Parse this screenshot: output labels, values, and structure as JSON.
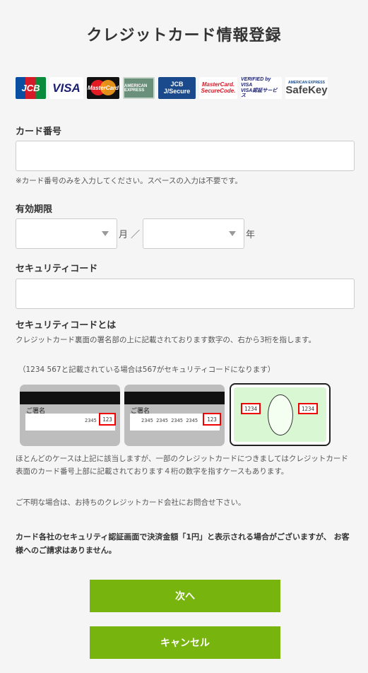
{
  "title": "クレジットカード情報登録",
  "logos": [
    {
      "name": "jcb",
      "text": "JCB"
    },
    {
      "name": "visa",
      "text": "VISA"
    },
    {
      "name": "mastercard",
      "text": "MasterCard"
    },
    {
      "name": "amex",
      "text": "AMERICAN EXPRESS"
    },
    {
      "name": "jsecure",
      "top": "JCB",
      "bottom": "J/Secure"
    },
    {
      "name": "mc-securecode",
      "top": "MasterCard.",
      "bottom": "SecureCode."
    },
    {
      "name": "verified-by-visa",
      "top": "VERIFIED by VISA",
      "bottom": "VISA認証サービス"
    },
    {
      "name": "safekey",
      "top": "AMERICAN EXPRESS",
      "bottom": "SafeKey"
    }
  ],
  "card_number": {
    "label": "カード番号",
    "value": "",
    "note": "※カード番号のみを入力してください。スペースの入力は不要です。"
  },
  "expiry": {
    "label": "有効期限",
    "month_value": "",
    "month_unit": "月",
    "separator": "／",
    "year_value": "",
    "year_unit": "年"
  },
  "security_code": {
    "label": "セキュリティコード",
    "value": ""
  },
  "security_help": {
    "heading": "セキュリティコードとは",
    "text1": "クレジットカード裏面の署名部の上に記載されております数字の、右から3桁を指します。",
    "text2": "（1234 567と記載されている場合は567がセキュリティコードになります）",
    "cards": [
      {
        "sign_label": "ご署名",
        "numbers": "2345",
        "code": "123"
      },
      {
        "sign_label": "ご署名",
        "numbers": "2345 2345 2345 2345",
        "code": "123"
      }
    ],
    "front_card": {
      "left_code": "1234",
      "right_code": "1234"
    },
    "text3": "ほとんどのケースは上記に該当しますが、一部のクレジットカードにつきましてはクレジットカード表面のカード番号上部に記載されております４桁の数字を指すケースもあります。",
    "text4": "ご不明な場合は、お持ちのクレジットカード会社にお問合せ下さい。"
  },
  "notice": "カード各社のセキュリティ認証画面で決済金額「1円」と表示される場合がございますが、 お客様へのご請求はありません。",
  "buttons": {
    "next": "次へ",
    "cancel": "キャンセル"
  },
  "colors": {
    "accent": "#78b40e",
    "highlight_box": "#ee0000",
    "background": "#f5f5f5"
  }
}
